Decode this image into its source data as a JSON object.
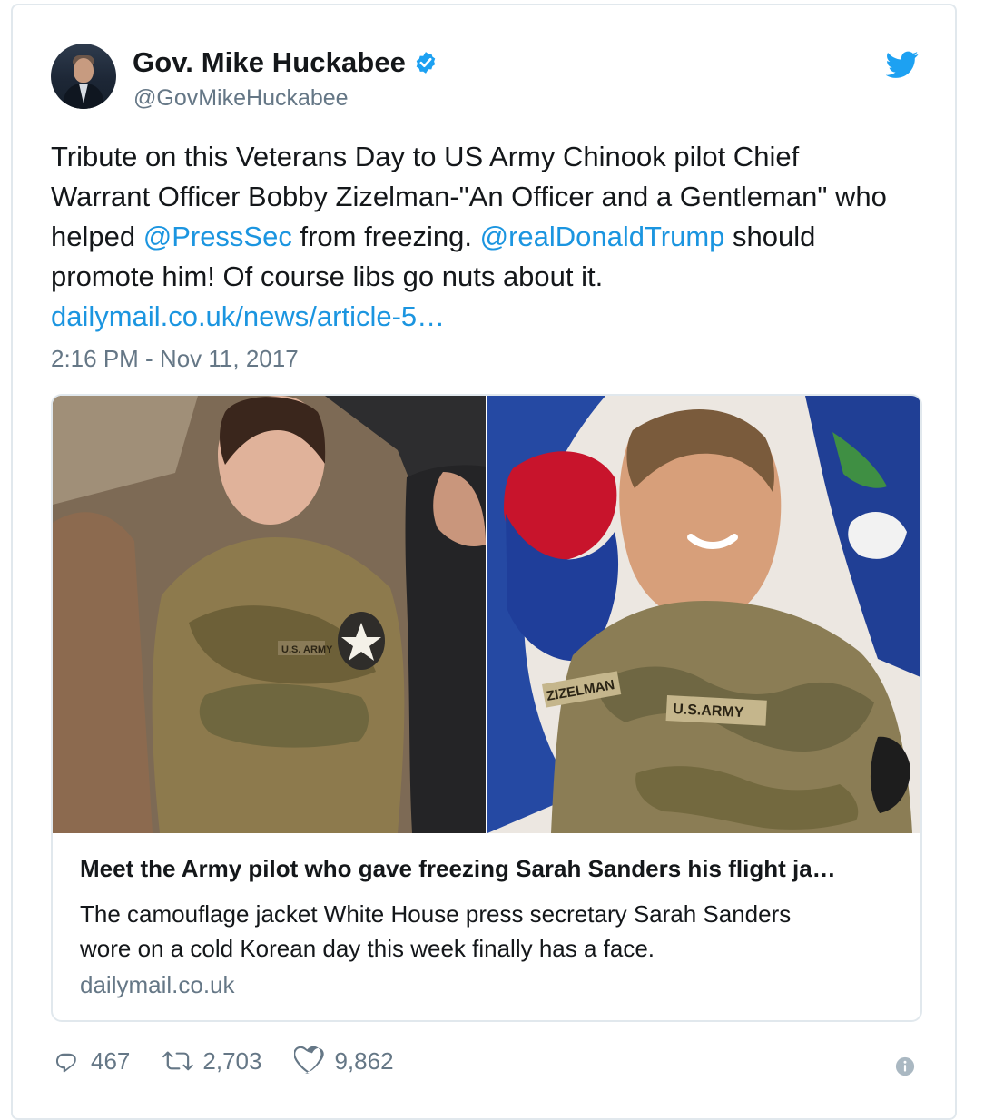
{
  "tweet": {
    "author": {
      "display_name": "Gov. Mike Huckabee",
      "handle": "@GovMikeHuckabee",
      "verified_icon": "verified-badge-icon",
      "avatar_icon": "avatar"
    },
    "text": {
      "line1": "Tribute on this Veterans Day to US Army Chinook pilot Chief",
      "line2": "Warrant Officer Bobby Zizelman-\"An Officer and a Gentleman\" who",
      "line3_pre": "helped ",
      "mention1": "@PressSec",
      "line3_mid": " from freezing. ",
      "mention2": "@realDonaldTrump",
      "line3_post": " should",
      "line4": "promote him! Of course libs go nuts about it.",
      "link": "dailymail.co.uk/news/article-5…"
    },
    "timestamp": "2:16 PM - Nov 11, 2017",
    "card": {
      "title": "Meet the Army pilot who gave freezing Sarah Sanders his flight ja…",
      "description_line1": "The camouflage jacket White House press secretary Sarah Sanders",
      "description_line2": "wore on a cold Korean day this week finally has a face.",
      "domain": "dailymail.co.uk",
      "left_patch": "U.S. ARMY",
      "right_name_tape": "ZIZELMAN",
      "right_army_tape": "U.S.ARMY"
    },
    "actions": {
      "replies": "467",
      "retweets": "2,703",
      "likes": "9,862"
    },
    "colors": {
      "link": "#1b95e0",
      "secondary": "#657786",
      "border": "#e1e8ed"
    }
  }
}
